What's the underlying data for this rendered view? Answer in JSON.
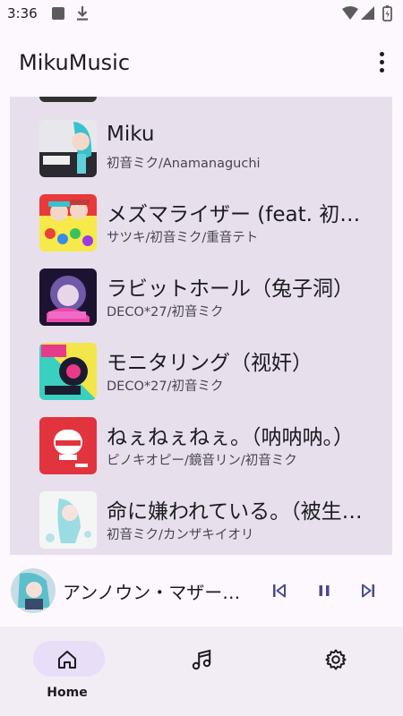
{
  "status_bar": {
    "time": "3:36",
    "icons": [
      "square-notification-icon",
      "download-icon",
      "wifi-icon",
      "signal-icon",
      "battery-icon"
    ]
  },
  "app_bar": {
    "title": "MikuMusic",
    "menu_icon": "more-vert-icon"
  },
  "songs": [
    {
      "title": "Miku",
      "artist": "初音ミク/Anamanaguchi"
    },
    {
      "title": " メズマライザー (feat. 初音ミク & 重音テトSV)",
      "artist": "サツキ/初音ミク/重音テト"
    },
    {
      "title": " ラビットホール（兔子洞）",
      "artist": "DECO*27/初音ミク"
    },
    {
      "title": "モニタリング（视奸）",
      "artist": "DECO*27/初音ミク"
    },
    {
      "title": " ねぇねぇねぇ。（呐呐呐。）",
      "artist": "ピノキオピー/鏡音リン/初音ミク"
    },
    {
      "title": " 命に嫌われている。（被生命所厌恶）",
      "artist": "初音ミク/カンザキイオリ"
    }
  ],
  "player": {
    "title": "アンノウン・マザーグース",
    "controls": [
      "skip-previous-icon",
      "pause-icon",
      "skip-next-icon"
    ],
    "state": "playing"
  },
  "nav": [
    {
      "label": "Home",
      "icon": "home-icon",
      "selected": true
    },
    {
      "label": "",
      "icon": "music-note-icon",
      "selected": false
    },
    {
      "label": "",
      "icon": "settings-icon",
      "selected": false
    }
  ],
  "colors": {
    "accent": "#4a4a8c",
    "panel": "#e7e0ec",
    "nav_bg": "#f2ecf4",
    "pill": "#e8def8",
    "background": "#fdf8fd"
  }
}
